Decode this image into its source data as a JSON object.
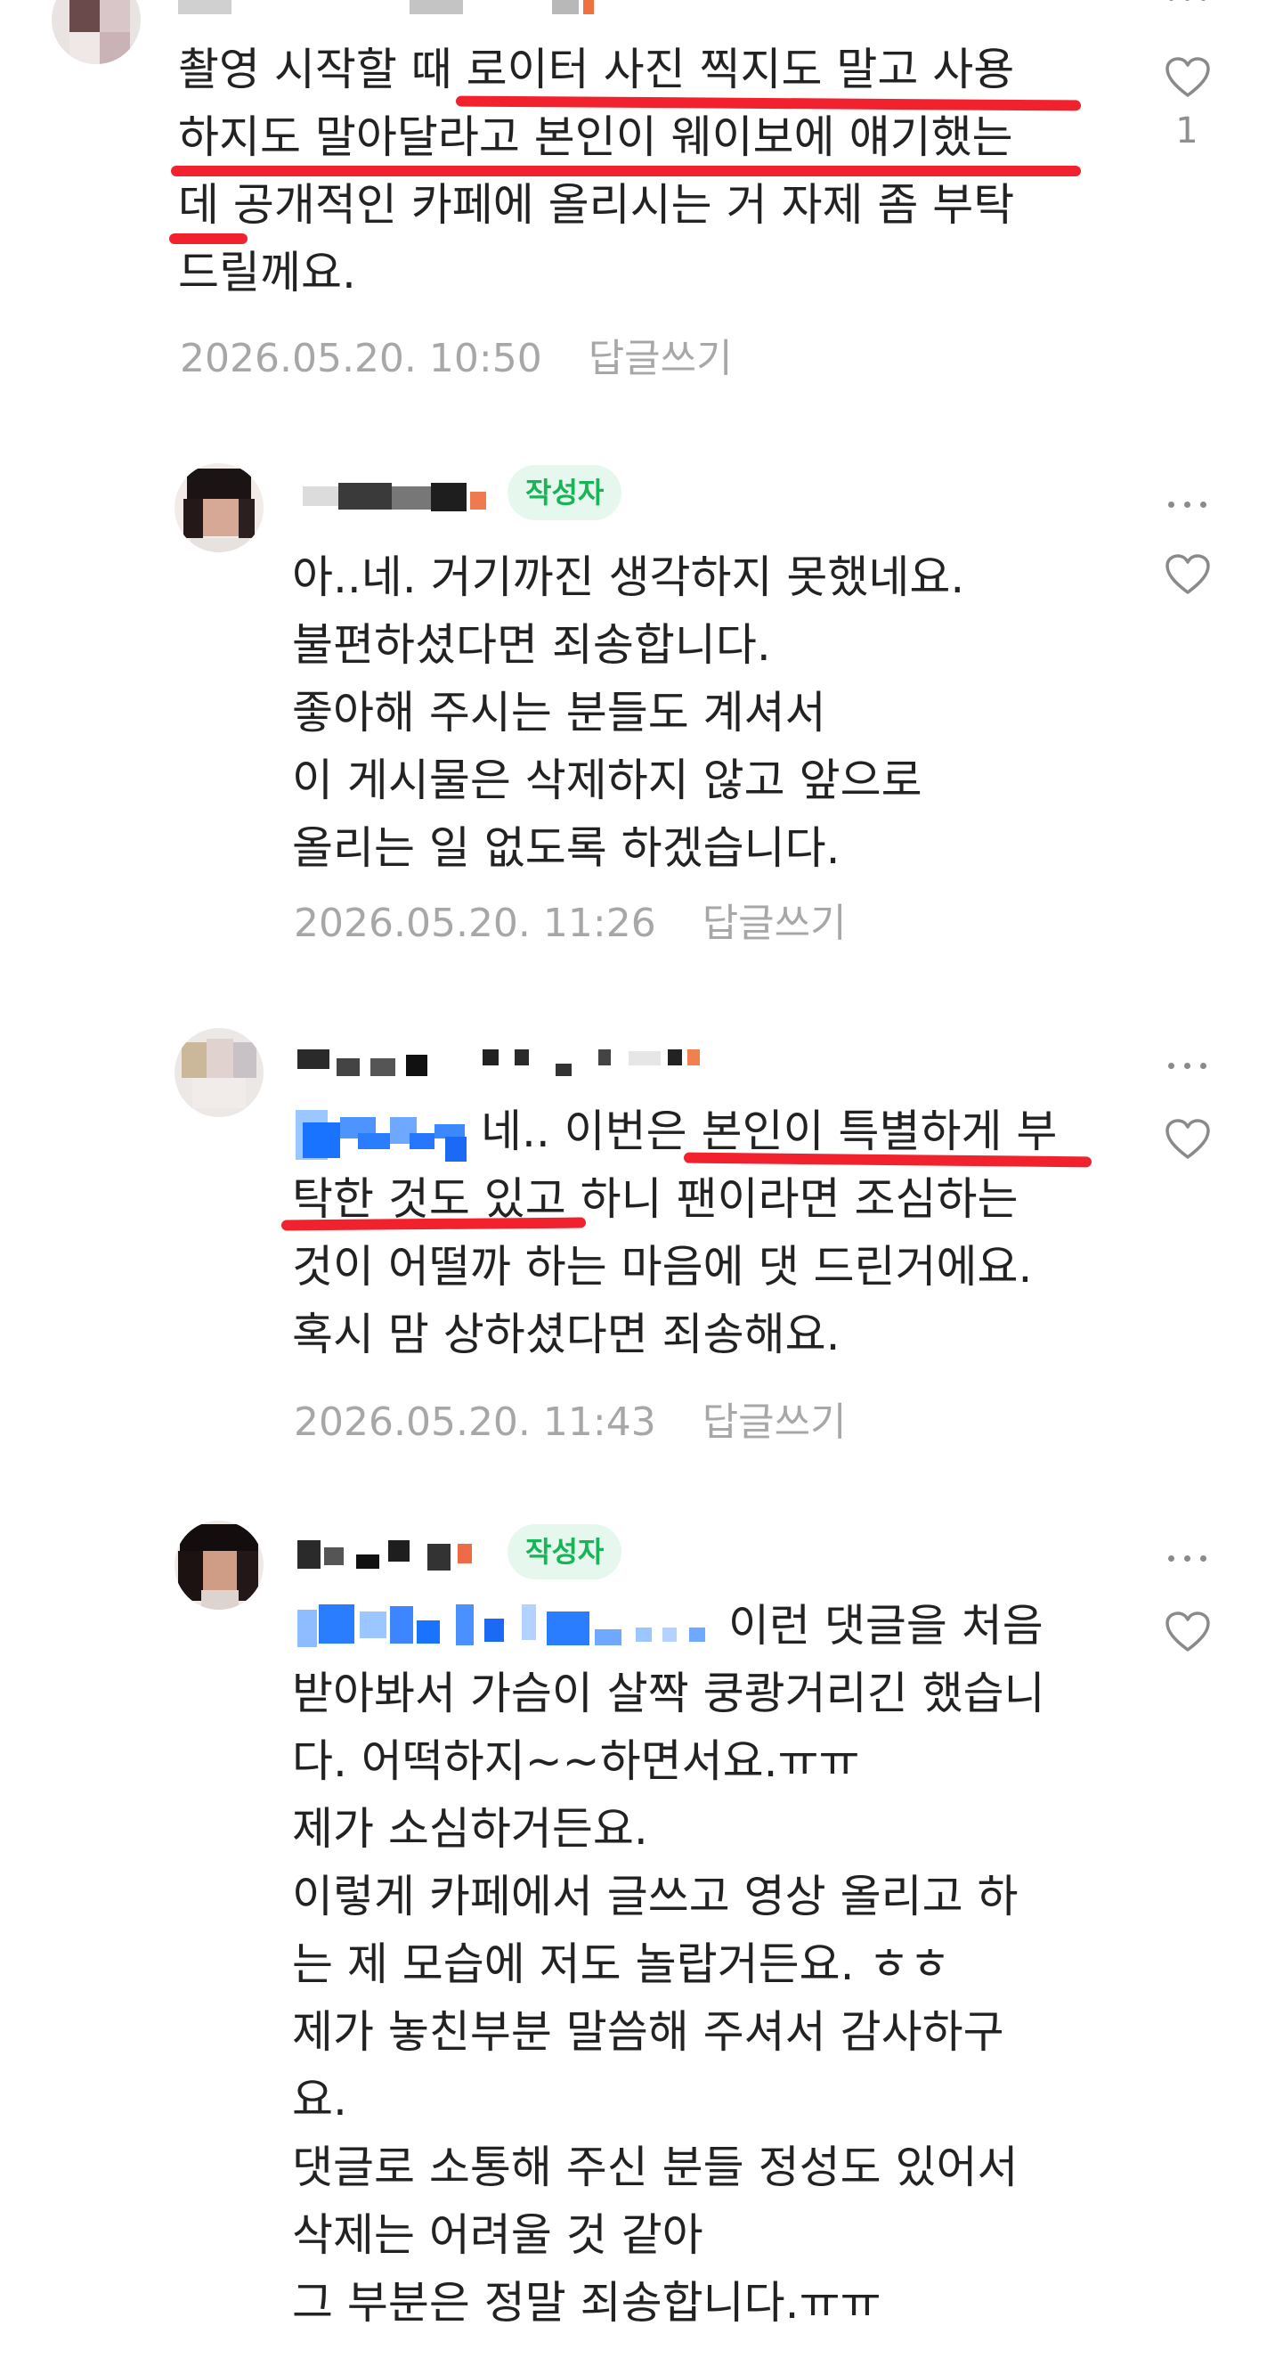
{
  "comments": [
    {
      "author_badge": "",
      "lines": [
        "촬영 시작할 때 로이터 사진 찍지도 말고 사용",
        "하지도 말아달라고 본인이 웨이보에 얘기했는",
        "데 공개적인 카페에 올리시는 거 자제 좀 부탁",
        "드릴께요."
      ],
      "date": "2026.05.20. 10:50",
      "reply_label": "답글쓰기",
      "like_count": "1"
    },
    {
      "author_badge": "작성자",
      "lines": [
        "아..네. 거기까진 생각하지 못했네요.",
        "불편하셨다면 죄송합니다.",
        "좋아해 주시는 분들도 계셔서",
        "이 게시물은 삭제하지 않고 앞으로",
        "올리는 일 없도록 하겠습니다."
      ],
      "date": "2026.05.20. 11:26",
      "reply_label": "답글쓰기"
    },
    {
      "author_badge": "",
      "first_line_rest": "네.. 이번은 본인이 특별하게 부",
      "lines": [
        "탁한 것도 있고 하니 팬이라면 조심하는",
        "것이 어떨까 하는 마음에 댓 드린거에요.",
        "혹시 맘 상하셨다면 죄송해요."
      ],
      "date": "2026.05.20. 11:43",
      "reply_label": "답글쓰기"
    },
    {
      "author_badge": "작성자",
      "first_line_rest": "이런 댓글을 처음",
      "lines": [
        "받아봐서 가슴이 살짝 쿵쾅거리긴 했습니",
        "다. 어떡하지~~하면서요.ㅠㅠ",
        "제가 소심하거든요.",
        "이렇게 카페에서 글쓰고 영상 올리고 하",
        "는 제 모습에 저도 놀랍거든요. ㅎㅎ",
        "제가 놓친부분 말씀해 주셔서 감사하구",
        "요.",
        "댓글로 소통해 주신 분들 정성도 있어서",
        "삭제는 어려울 것 같아",
        "그 부분은 정말 죄송합니다.ㅠㅠ"
      ]
    }
  ],
  "icons": {
    "more": "more-dots-icon",
    "like": "heart-outline-icon"
  },
  "colors": {
    "text": "#222222",
    "meta": "#a7a7a7",
    "author_badge_bg": "#e6f8ed",
    "author_badge_text": "#18b457",
    "highlight_underline": "#f1222e",
    "mention_blur": "#1a73ff"
  }
}
